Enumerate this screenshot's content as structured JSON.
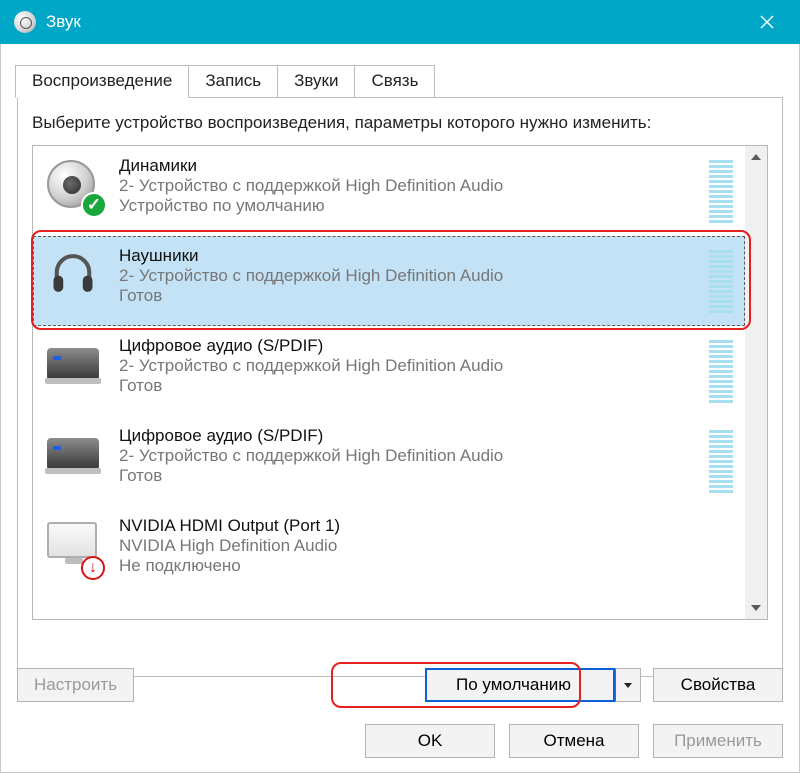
{
  "window": {
    "title": "Звук"
  },
  "tabs": {
    "playback": "Воспроизведение",
    "recording": "Запись",
    "sounds": "Звуки",
    "comm": "Связь"
  },
  "instruction": "Выберите устройство воспроизведения, параметры которого нужно изменить:",
  "devices": [
    {
      "title": "Динамики",
      "line2": "2- Устройство с поддержкой High Definition Audio",
      "status": "Устройство по умолчанию"
    },
    {
      "title": "Наушники",
      "line2": "2- Устройство с поддержкой High Definition Audio",
      "status": "Готов"
    },
    {
      "title": "Цифровое аудио (S/PDIF)",
      "line2": "2- Устройство с поддержкой High Definition Audio",
      "status": "Готов"
    },
    {
      "title": "Цифровое аудио (S/PDIF)",
      "line2": "2- Устройство с поддержкой High Definition Audio",
      "status": "Готов"
    },
    {
      "title": "NVIDIA HDMI Output (Port 1)",
      "line2": "NVIDIA High Definition Audio",
      "status": "Не подключено"
    }
  ],
  "buttons": {
    "configure": "Настроить",
    "set_default": "По умолчанию",
    "properties": "Свойства",
    "ok": "OK",
    "cancel": "Отмена",
    "apply": "Применить"
  }
}
